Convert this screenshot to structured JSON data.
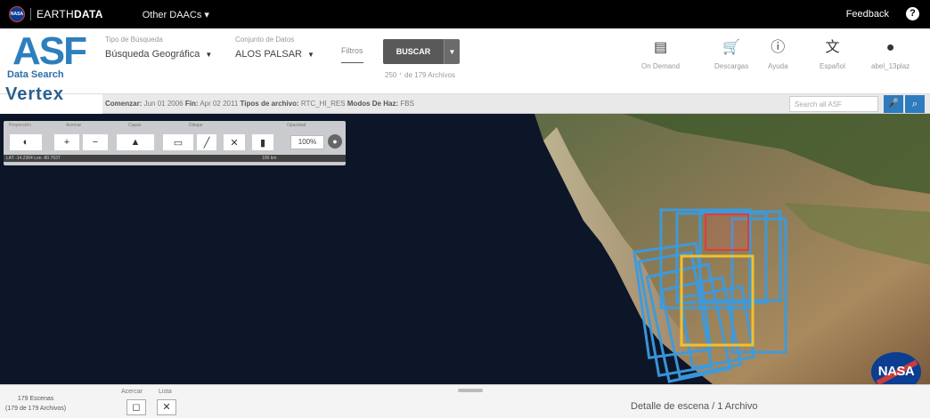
{
  "topbar": {
    "brand_prefix": "|",
    "brand_earth": "EARTH",
    "brand_data": "DATA",
    "other_daacs": "Other DAACs",
    "other_daacs_caret": "▾",
    "feedback": "Feedback",
    "help_icon": "question-circle-icon"
  },
  "logo": {
    "asf": "ASF",
    "data_search": "Data Search",
    "vertex": "Vertex"
  },
  "header": {
    "search_type_label": "Tipo de Búsqueda",
    "search_type_value": "Búsqueda Geográfica",
    "dataset_label": "Conjunto de Datos",
    "dataset_value": "ALOS PALSAR",
    "filters": "Filtros",
    "search_button": "BUSCAR",
    "results_count": "250 ⁺ de 179 Archivos",
    "tools": [
      {
        "icon": "on-demand-icon",
        "label": "On Demand"
      },
      {
        "icon": "cart-icon",
        "label": "Descargas"
      },
      {
        "icon": "help-icon",
        "label": "Ayuda"
      },
      {
        "icon": "language-icon",
        "label": "Español"
      },
      {
        "icon": "user-icon",
        "label": "abel_13plaz"
      }
    ]
  },
  "strip": {
    "start_label": "Comenzar:",
    "start_value": "Jun 01 2006",
    "end_label": "Fin:",
    "end_value": "Apr 02 2011",
    "types_label": "Tipos de archivo:",
    "types_value": "RTC_HI_RES",
    "mode_label": "Modos De Haz:",
    "mode_value": "FBS",
    "search_placeholder": "Search all ASF"
  },
  "map_toolbar": {
    "labels": [
      "Proyección",
      "Acercar",
      "Capas",
      "Dibujar",
      "Zoom de Imagen",
      "Opacidad"
    ],
    "zoom_value": "100%",
    "lat_text": "LAT -14.2364",
    "lon_text": "Lon -80.7637",
    "scale": "100 km"
  },
  "nasa_logo": "NASA",
  "bottom": {
    "scenes_line1": "179 Escenas",
    "scenes_line2": "(179 de 179 Archivos)",
    "zoom_label": "Acercar",
    "list_label": "Lista",
    "detail": "Detalle de escena / 1 Archivo"
  }
}
